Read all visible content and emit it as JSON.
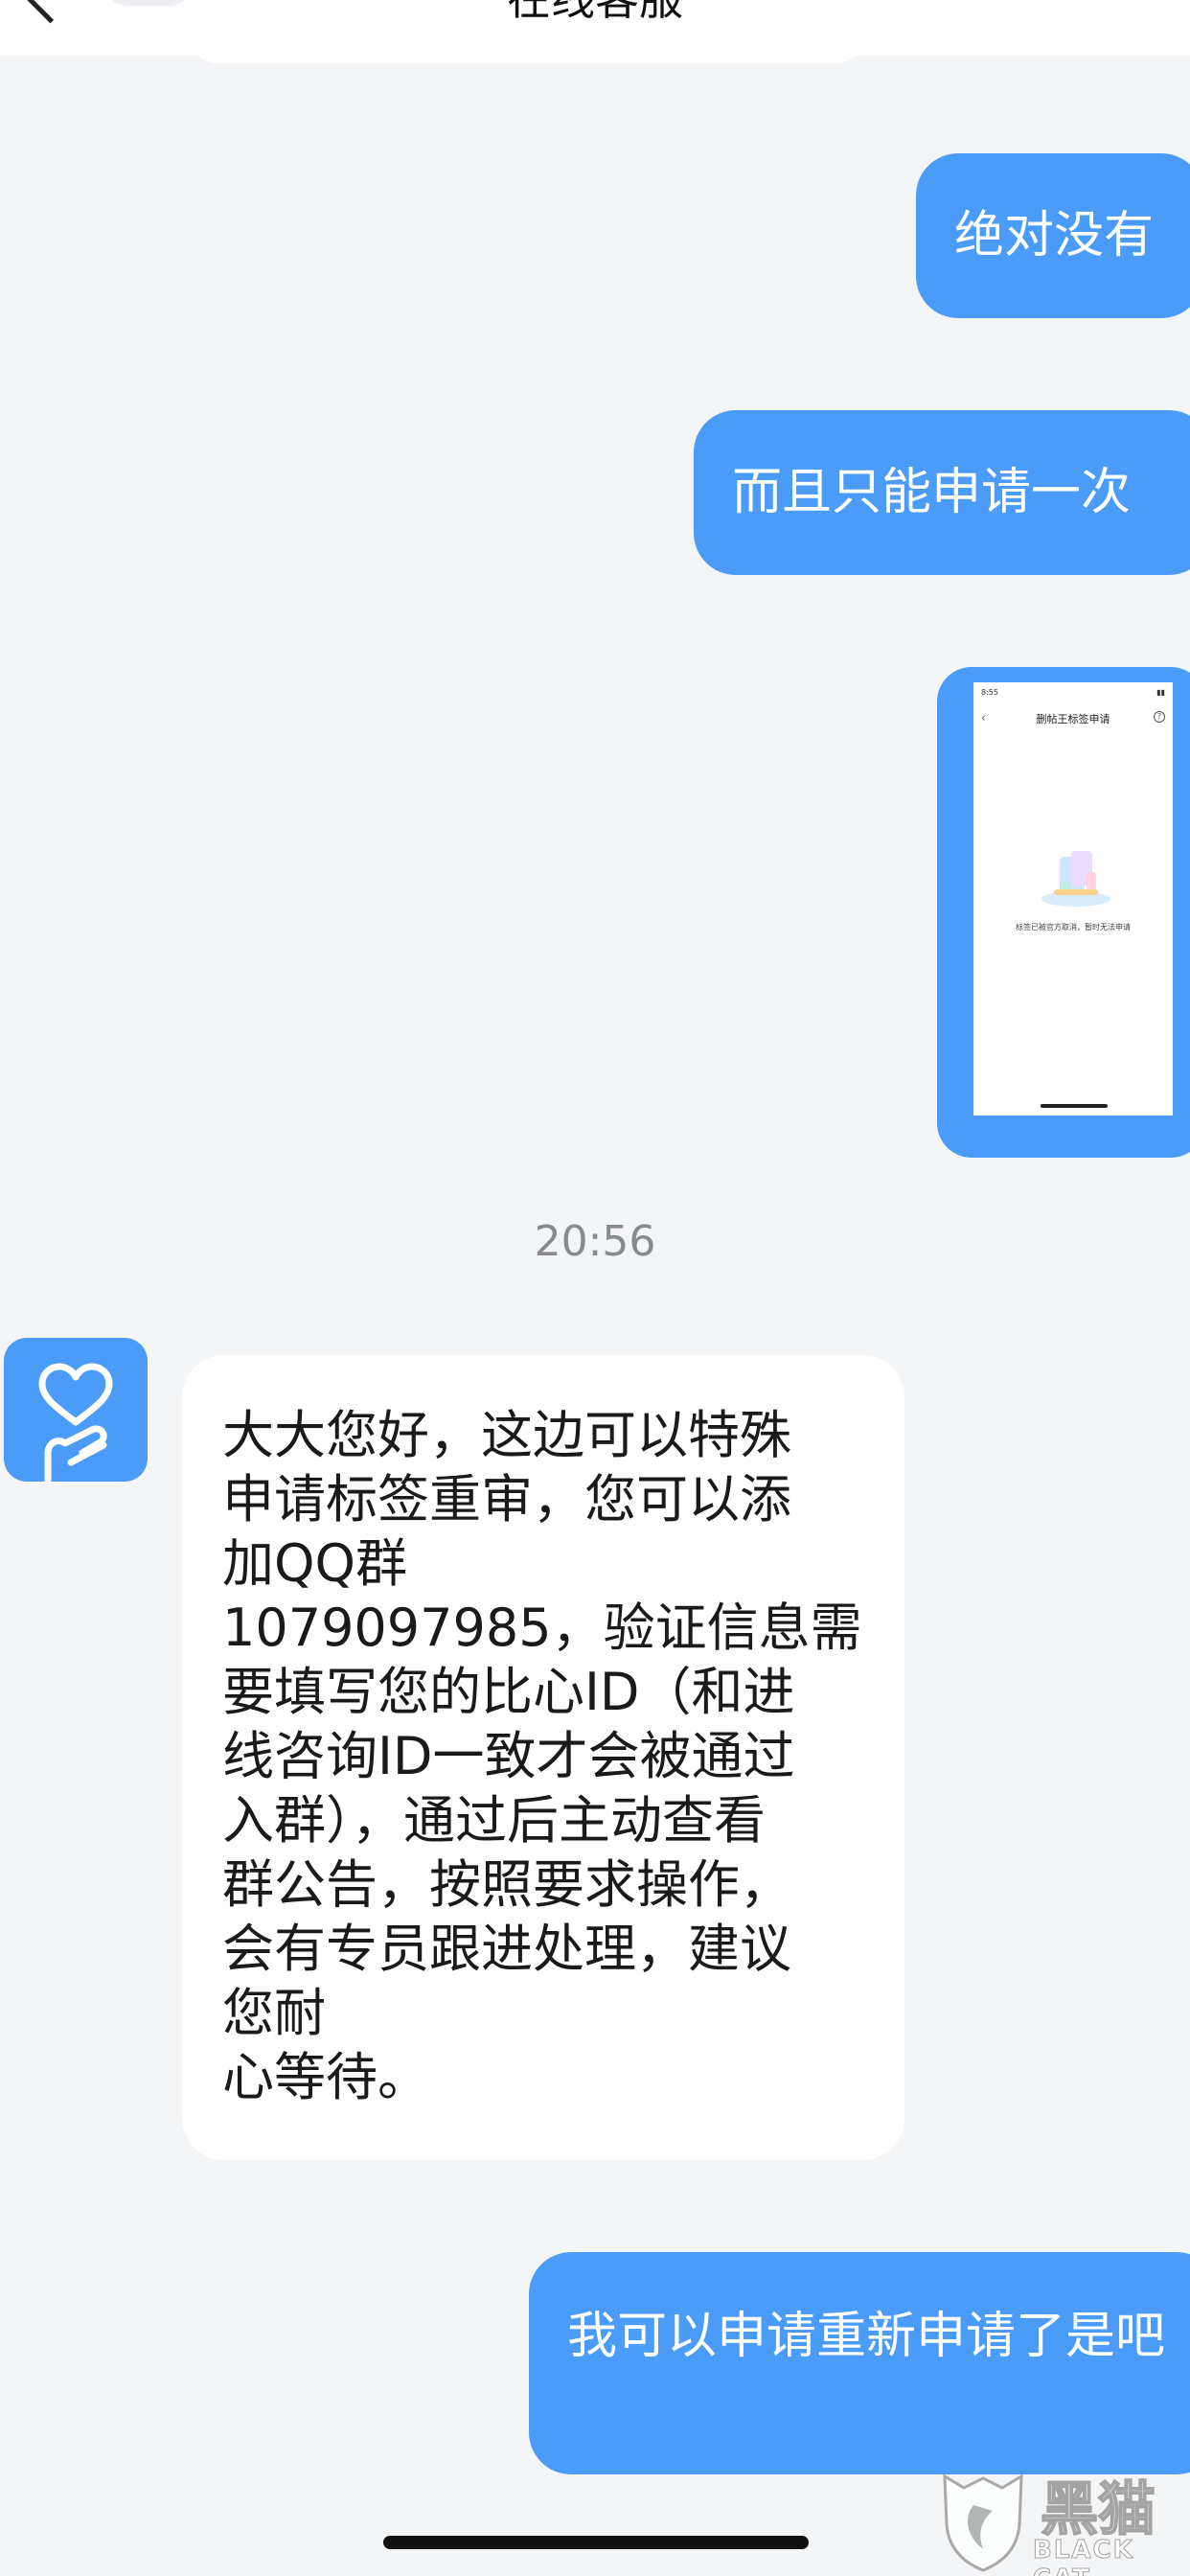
{
  "header": {
    "title": "在线客服"
  },
  "messages": {
    "out_1": "绝对没有",
    "out_2": "而且只能申请一次",
    "image_thumb": {
      "status_time": "8:55",
      "nav_title": "删帖王标签申请",
      "caption": "标签已被官方取消，暂时无法申请"
    },
    "timestamp": "20:56",
    "in_1_lines": [
      "大大您好，这边可以特殊",
      "申请标签重审，您可以添",
      "加QQ群",
      "1079097985，验证信息需",
      "要填写您的比心ID（和进",
      "线咨询ID一致才会被通过",
      "入群），通过后主动查看",
      "群公告，按照要求操作，",
      "会有专员跟进处理，建议",
      "您耐",
      "心等待。"
    ],
    "out_3": "我可以申请重新申请了是吧"
  },
  "watermark": {
    "cn": "黑猫",
    "en": "BLACK CAT"
  },
  "colors": {
    "outgoing_bubble": "#4b9bf8",
    "incoming_bubble": "#ffffff",
    "background": "#f4f5f7"
  },
  "icons": {
    "avatar": "heart-hand-avatar-icon",
    "back": "chevron-left-icon"
  }
}
